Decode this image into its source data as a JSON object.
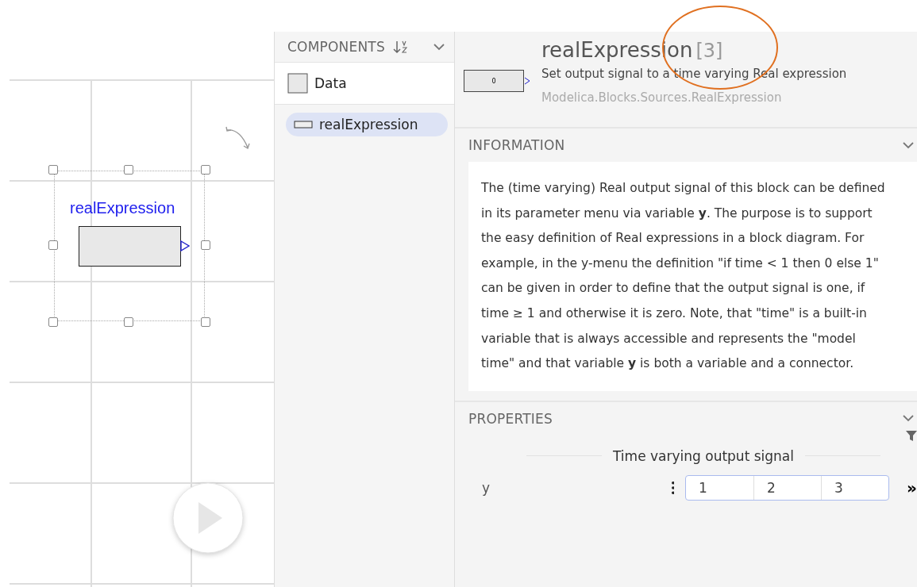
{
  "canvas": {
    "block": {
      "label": "realExpression",
      "selected": true
    }
  },
  "components": {
    "title": "COMPONENTS",
    "items": [
      {
        "label": "Data",
        "kind": "record",
        "selected": false
      },
      {
        "label": "realExpression",
        "kind": "block",
        "selected": true
      }
    ]
  },
  "header": {
    "block_value": "0",
    "name": "realExpression",
    "count": "[3]",
    "description": "Set output signal to a time varying Real expression",
    "path": "Modelica.Blocks.Sources.RealExpression"
  },
  "information": {
    "title": "INFORMATION",
    "text": "The (time varying) Real output signal of this block can be defined in its parameter menu via variable **y**. The purpose is to support the easy definition of Real expressions in a block diagram. For example, in the y-menu the definition \"if time < 1 then 0 else 1\" can be given in order to define that the output signal is one, if time ≥ 1 and otherwise it is zero. Note, that \"time\" is a built-in variable that is always accessible and represents the \"model time\" and that variable **y** is both a variable and a connector."
  },
  "properties": {
    "title": "PROPERTIES",
    "group": "Time varying output signal",
    "parameters": [
      {
        "name": "y",
        "values": [
          "1",
          "2",
          "3"
        ],
        "more": "»"
      }
    ]
  },
  "annotation": {
    "kind": "circle"
  }
}
